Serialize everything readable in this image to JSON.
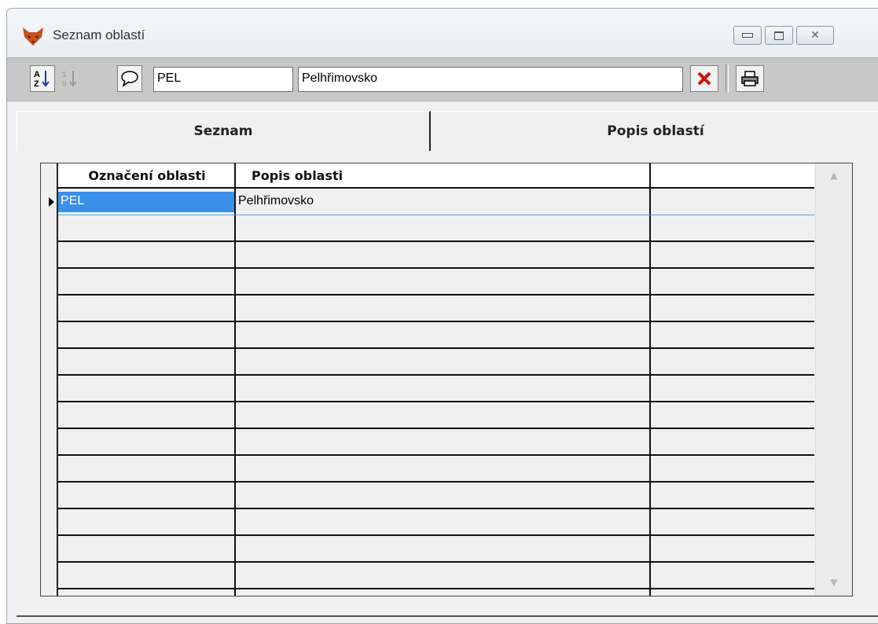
{
  "window": {
    "title": "Seznam oblastí"
  },
  "toolbar": {
    "code_value": "PEL",
    "description_value": "Pelhřimovsko"
  },
  "tabs": [
    {
      "label": "Seznam",
      "active": true
    },
    {
      "label": "Popis oblastí",
      "active": false
    }
  ],
  "grid": {
    "columns": [
      "Označení oblasti",
      "Popis oblasti",
      ""
    ],
    "rows": [
      {
        "code": "PEL",
        "description": "Pelhřimovsko",
        "selected": true
      }
    ],
    "empty_row_count": 14
  },
  "colors": {
    "selection": "#3a8fe8",
    "toolbar": "#c8c8c8",
    "close_red": "#cc1111"
  }
}
